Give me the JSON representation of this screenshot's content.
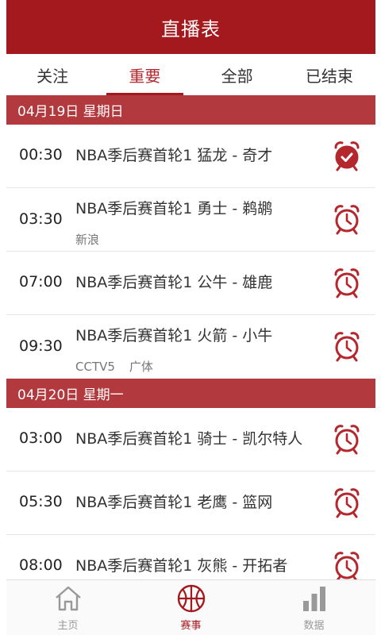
{
  "header": {
    "title": "直播表"
  },
  "tabs": [
    "关注",
    "重要",
    "全部",
    "已结束"
  ],
  "active_tab_index": 1,
  "sections": [
    {
      "date_label": "04月19日 星期日",
      "games": [
        {
          "time": "00:30",
          "title": "NBA季后赛首轮1 猛龙 - 奇才",
          "channels": [],
          "reminder_on": true
        },
        {
          "time": "03:30",
          "title": "NBA季后赛首轮1 勇士 - 鹈鹕",
          "channels": [
            "新浪"
          ],
          "reminder_on": false
        },
        {
          "time": "07:00",
          "title": "NBA季后赛首轮1 公牛 - 雄鹿",
          "channels": [],
          "reminder_on": false
        },
        {
          "time": "09:30",
          "title": "NBA季后赛首轮1 火箭 - 小牛",
          "channels": [
            "CCTV5",
            "广体"
          ],
          "reminder_on": false
        }
      ]
    },
    {
      "date_label": "04月20日 星期一",
      "games": [
        {
          "time": "03:00",
          "title": "NBA季后赛首轮1 骑士 - 凯尔特人",
          "channels": [],
          "reminder_on": false
        },
        {
          "time": "05:30",
          "title": "NBA季后赛首轮1 老鹰 - 篮网",
          "channels": [],
          "reminder_on": false
        },
        {
          "time": "08:00",
          "title": "NBA季后赛首轮1 灰熊 - 开拓者",
          "channels": [],
          "reminder_on": false
        }
      ]
    }
  ],
  "bottom_nav": [
    {
      "label": "主页",
      "icon": "home-icon"
    },
    {
      "label": "赛事",
      "icon": "basketball-icon"
    },
    {
      "label": "数据",
      "icon": "bar-chart-icon"
    }
  ],
  "bottom_nav_active_index": 1,
  "colors": {
    "brand": "#a3191e",
    "section_bar": "#b23a3f",
    "alarm": "#b3272d"
  }
}
